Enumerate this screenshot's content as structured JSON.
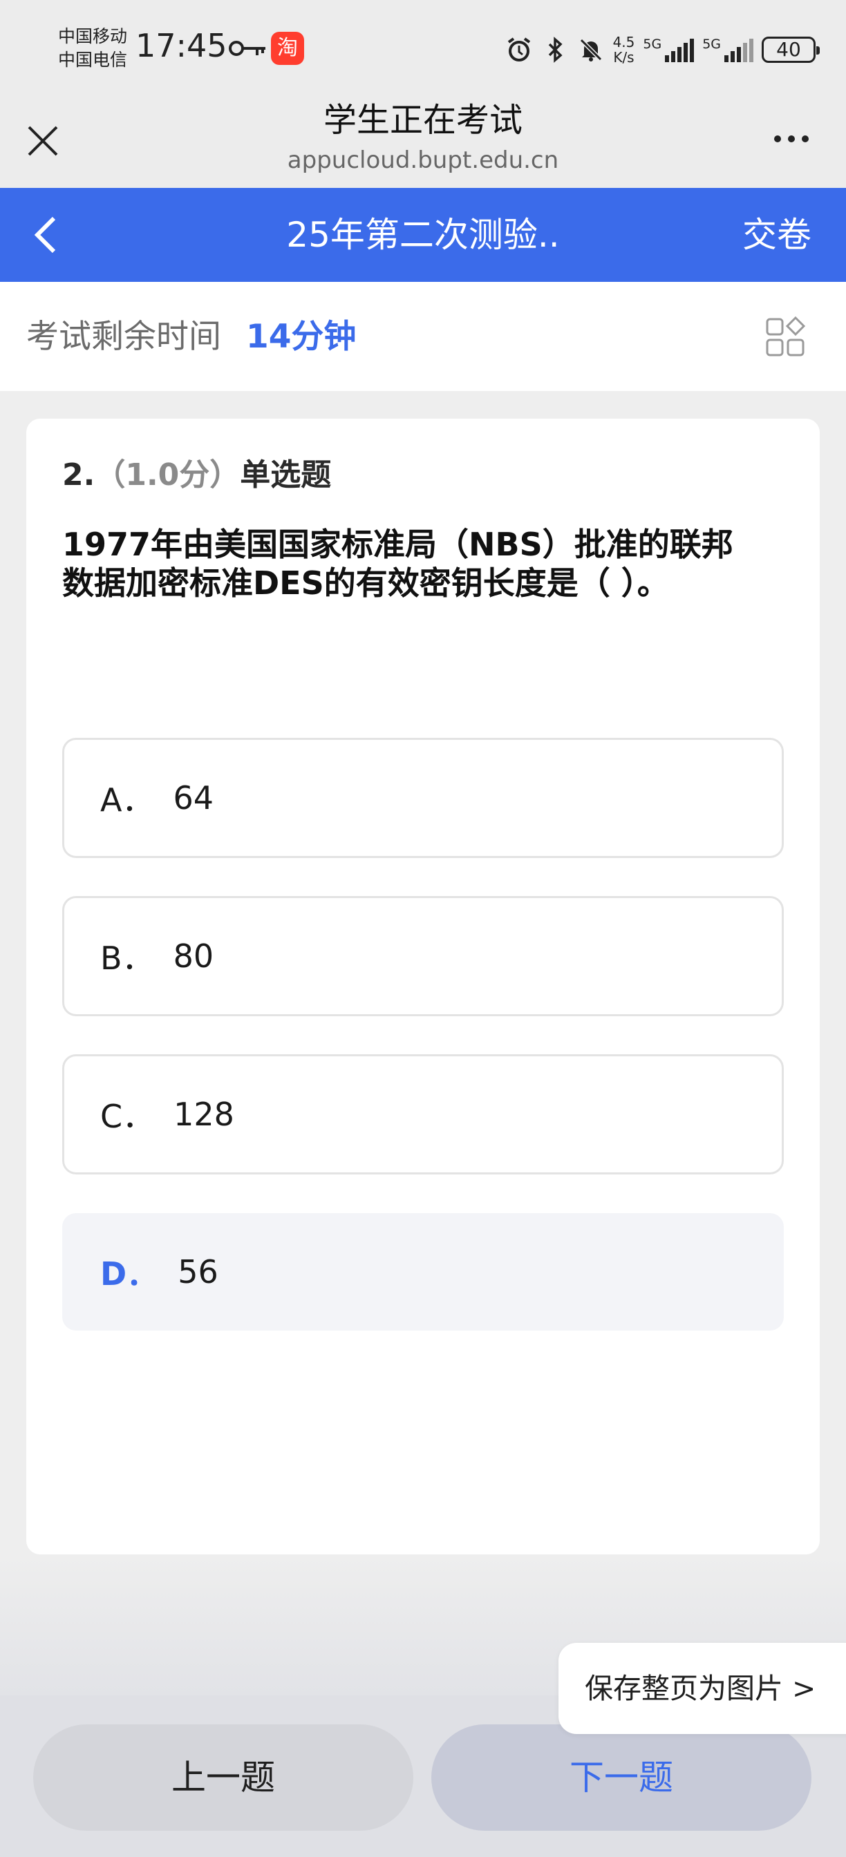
{
  "status_bar": {
    "carrier_1": "中国移动",
    "carrier_2": "中国电信",
    "time": "17:45",
    "net_speed_value": "4.5",
    "net_speed_unit": "K/s",
    "signal_1_label": "5G",
    "signal_2_label": "5G",
    "battery": "40",
    "icons": [
      "key-icon",
      "taobao-icon",
      "alarm-icon",
      "bluetooth-icon",
      "mute-icon"
    ]
  },
  "browser": {
    "title": "学生正在考试",
    "url": "appucloud.bupt.edu.cn"
  },
  "exam": {
    "title": "25年第二次测验..",
    "submit_label": "交卷",
    "time_label": "考试剩余时间",
    "time_value": "14分钟",
    "accent_color": "#3b6bea"
  },
  "question": {
    "number": "2.",
    "score": "（1.0分）",
    "type": "单选题",
    "text_line1": "1977年由美国国家标准局（NBS）批准的联邦",
    "text_line2": "数据加密标准DES的有效密钥长度是（ ）。",
    "options": [
      {
        "letter": "A．",
        "value": "64"
      },
      {
        "letter": "B．",
        "value": "80"
      },
      {
        "letter": "C．",
        "value": "128"
      },
      {
        "letter": "D．",
        "value": "56"
      }
    ],
    "selected": "D"
  },
  "footer": {
    "prev_label": "上一题",
    "next_label": "下一题",
    "save_popup": "保存整页为图片 >"
  }
}
